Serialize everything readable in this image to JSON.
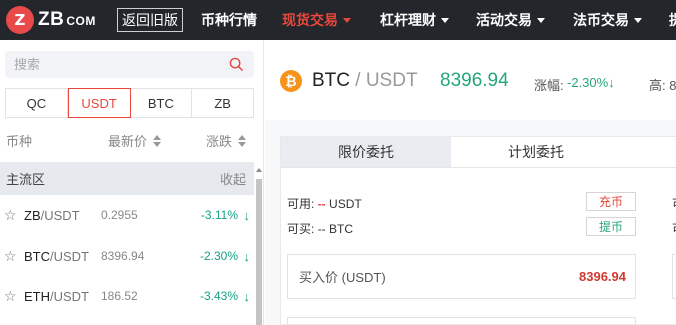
{
  "nav": {
    "logo_mark": "Z",
    "logo_text": "ZB",
    "logo_suffix": "COM",
    "old_version": "返回旧版",
    "items": [
      {
        "label": "币种行情"
      },
      {
        "label": "现货交易"
      },
      {
        "label": "杠杆理财"
      },
      {
        "label": "活动交易"
      },
      {
        "label": "法币交易"
      },
      {
        "label": "提"
      }
    ],
    "active_color": "#e8473c"
  },
  "sidebar": {
    "search_placeholder": "搜索",
    "quote_tabs": [
      "QC",
      "USDT",
      "BTC",
      "ZB"
    ],
    "active_quote": "USDT",
    "columns": {
      "coin": "币种",
      "price": "最新价",
      "change": "涨跌"
    },
    "zone": {
      "label": "主流区",
      "fold": "收起"
    },
    "rows": [
      {
        "base": "ZB",
        "quote": "/USDT",
        "price": "0.2955",
        "change": "-3.11%",
        "arrow": "↓"
      },
      {
        "base": "BTC",
        "quote": "/USDT",
        "price": "8396.94",
        "change": "-2.30%",
        "arrow": "↓"
      },
      {
        "base": "ETH",
        "quote": "/USDT",
        "price": "186.52",
        "change": "-3.43%",
        "arrow": "↓"
      }
    ]
  },
  "ticker": {
    "coin_symbol": "₿",
    "base": "BTC",
    "quote": " / USDT",
    "price": "8396.94",
    "change_label": "涨幅:",
    "change": "-2.30%↓",
    "high_label": "高: 8",
    "up_color": "#27a67e"
  },
  "order": {
    "tabs": [
      "限价委托",
      "计划委托"
    ],
    "available_label": "可用:",
    "available_value": "--",
    "available_unit": "USDT",
    "buyable_label": "可买:",
    "buyable_value": "--",
    "buyable_unit": "BTC",
    "deposit": "充币",
    "withdraw": "提币",
    "right_col_1": "可",
    "right_col_2": "可",
    "buy_price_label": "买入价 (USDT)",
    "buy_price_value": "8396.94"
  }
}
